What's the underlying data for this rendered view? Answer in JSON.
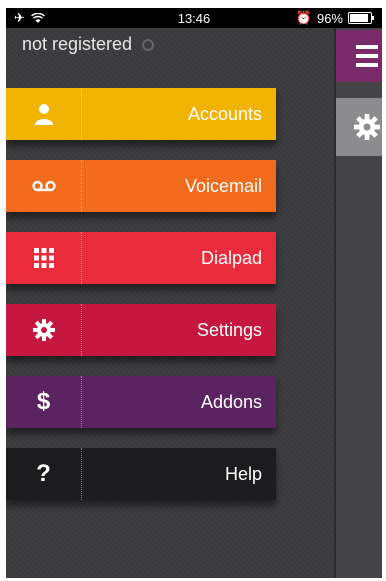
{
  "status_bar": {
    "time": "13:46",
    "battery": "96%",
    "icons": [
      "airplane-icon",
      "wifi-icon",
      "alarm-icon",
      "battery-icon"
    ]
  },
  "registration": {
    "text": "not registered"
  },
  "menu": {
    "items": [
      {
        "label": "Accounts",
        "icon": "person-icon",
        "color": "#f0b400"
      },
      {
        "label": "Voicemail",
        "icon": "voicemail-icon",
        "color": "#f26a1b"
      },
      {
        "label": "Dialpad",
        "icon": "dialpad-icon",
        "color": "#ea2b3c"
      },
      {
        "label": "Settings",
        "icon": "gear-icon",
        "color": "#c5173f"
      },
      {
        "label": "Addons",
        "icon": "dollar-icon",
        "color": "#5b2460"
      },
      {
        "label": "Help",
        "icon": "question-icon",
        "color": "#1c1c1e"
      }
    ]
  },
  "colors": {
    "panel_bg": "#3a3a3d",
    "hamburger_bg": "#7a2a6a",
    "gear_btn_bg": "#8c8c8e"
  }
}
